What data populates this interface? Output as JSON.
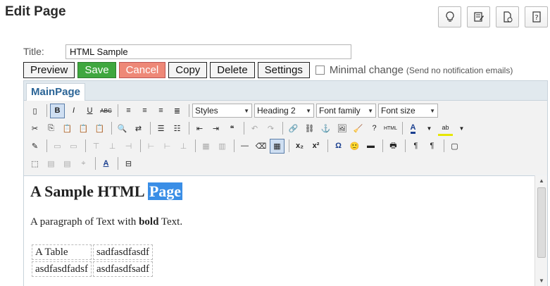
{
  "page": {
    "title": "Edit Page"
  },
  "top_icons": [
    "lightbulb-icon",
    "edit-document-icon",
    "document-settings-icon",
    "help-icon"
  ],
  "form": {
    "title_label": "Title:",
    "title_value": "HTML Sample"
  },
  "buttons": {
    "preview": "Preview",
    "save": "Save",
    "cancel": "Cancel",
    "copy": "Copy",
    "delete": "Delete",
    "settings": "Settings"
  },
  "minimal_change": {
    "label": "Minimal change",
    "note": "(Send no notification emails)"
  },
  "tabs": [
    {
      "label": "MainPage"
    }
  ],
  "toolbar": {
    "styles": "Styles",
    "format": "Heading 2",
    "font_family": "Font family",
    "font_size": "Font size"
  },
  "content": {
    "heading_plain": "A Sample HTML",
    "heading_selected": "Page",
    "para_before": "A paragraph of Text with",
    "para_bold": "bold",
    "para_after": "Text.",
    "table": [
      [
        "A Table",
        "sadfasdfasdf"
      ],
      [
        "asdfasdfadsf",
        "asdfasdfsadf"
      ]
    ]
  },
  "colors": {
    "save_bg": "#3fa73f",
    "cancel_bg": "#ee8877",
    "tab_text": "#2a6496",
    "selection": "#3a8ee6"
  }
}
